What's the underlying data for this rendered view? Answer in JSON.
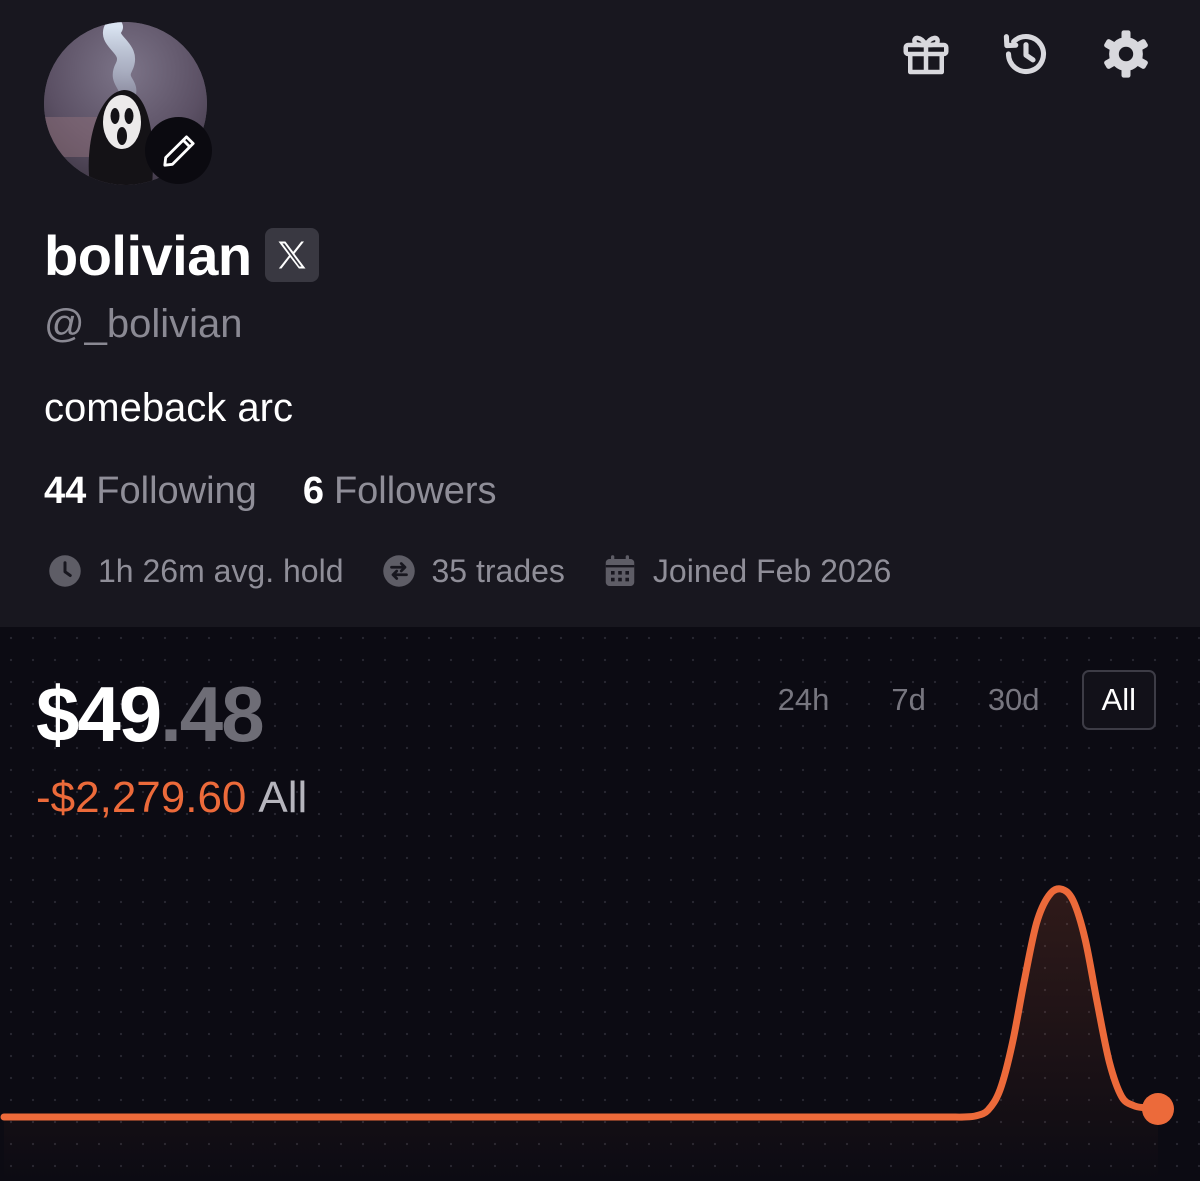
{
  "header_icons": {
    "gift": "gift-icon",
    "history": "history-icon",
    "settings": "gear-icon"
  },
  "profile": {
    "display_name": "bolivian",
    "social_badge": "X",
    "handle": "@_bolivian",
    "bio": "comeback arc",
    "following_count": "44",
    "following_label": "Following",
    "followers_count": "6",
    "followers_label": "Followers",
    "stats": [
      {
        "icon": "clock-icon",
        "text": "1h 26m avg. hold"
      },
      {
        "icon": "swap-icon",
        "text": "35 trades"
      },
      {
        "icon": "calendar-icon",
        "text": "Joined Feb 2026"
      }
    ]
  },
  "portfolio": {
    "balance_integer": "$49",
    "balance_decimal": ".48",
    "pnl_value": "-$2,279.60",
    "pnl_period": "All",
    "ranges": [
      "24h",
      "7d",
      "30d",
      "All"
    ],
    "active_range": "All"
  },
  "colors": {
    "background": "#18171f",
    "chart_background": "#0c0b13",
    "accent": "#ec6a3a",
    "muted_text": "#8f8e98"
  },
  "chart_data": {
    "type": "line",
    "series": [
      {
        "values": [
          0,
          0,
          0,
          0,
          0,
          0,
          0,
          0,
          0,
          0,
          0,
          0,
          0,
          0,
          0,
          0,
          0,
          0,
          0,
          0,
          0,
          0,
          0,
          0,
          0,
          0,
          0,
          0,
          0,
          0,
          0,
          0,
          0,
          0,
          0,
          0,
          0,
          0,
          0,
          0,
          0,
          0,
          0,
          0,
          0,
          0,
          0,
          0,
          0,
          0,
          0,
          0,
          0,
          0,
          0,
          0,
          0,
          0,
          0,
          0,
          0,
          0,
          0,
          0,
          0,
          0,
          0,
          0,
          0,
          0,
          0,
          0,
          0,
          0,
          0,
          0,
          0,
          0,
          0,
          0,
          0.5,
          3,
          12,
          32,
          60,
          85,
          97,
          100,
          95,
          78,
          50,
          24,
          9,
          5,
          4,
          3.5
        ]
      }
    ],
    "grid": true,
    "xlabel": "",
    "ylabel": "",
    "end_marker": true
  }
}
